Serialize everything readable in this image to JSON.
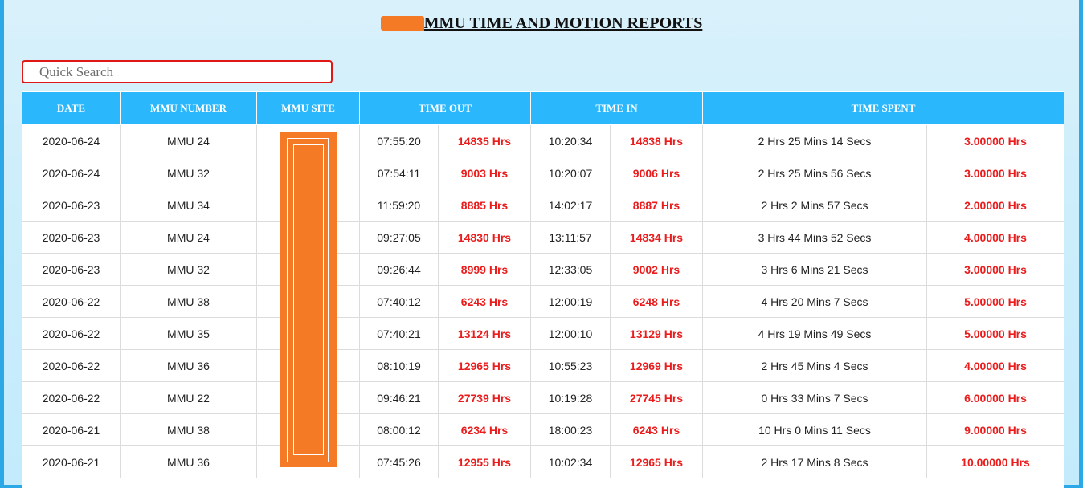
{
  "page": {
    "title": "MMU TIME AND MOTION REPORTS"
  },
  "search": {
    "placeholder": "Quick Search"
  },
  "table": {
    "headers": {
      "date": "DATE",
      "mmu_number": "MMU NUMBER",
      "mmu_site": "MMU SITE",
      "time_out": "TIME OUT",
      "time_in": "TIME IN",
      "time_spent": "TIME SPENT"
    },
    "rows": [
      {
        "date": "2020-06-24",
        "mmu": "MMU 24",
        "time_out": "07:55:20",
        "out_hrs": "14835 Hrs",
        "time_in": "10:20:34",
        "in_hrs": "14838 Hrs",
        "spent": "2 Hrs 25 Mins 14 Secs",
        "spent_hrs": "3.00000 Hrs"
      },
      {
        "date": "2020-06-24",
        "mmu": "MMU 32",
        "time_out": "07:54:11",
        "out_hrs": "9003 Hrs",
        "time_in": "10:20:07",
        "in_hrs": "9006 Hrs",
        "spent": "2 Hrs 25 Mins 56 Secs",
        "spent_hrs": "3.00000 Hrs"
      },
      {
        "date": "2020-06-23",
        "mmu": "MMU 34",
        "time_out": "11:59:20",
        "out_hrs": "8885 Hrs",
        "time_in": "14:02:17",
        "in_hrs": "8887 Hrs",
        "spent": "2 Hrs 2 Mins 57 Secs",
        "spent_hrs": "2.00000 Hrs"
      },
      {
        "date": "2020-06-23",
        "mmu": "MMU 24",
        "time_out": "09:27:05",
        "out_hrs": "14830 Hrs",
        "time_in": "13:11:57",
        "in_hrs": "14834 Hrs",
        "spent": "3 Hrs 44 Mins 52 Secs",
        "spent_hrs": "4.00000 Hrs"
      },
      {
        "date": "2020-06-23",
        "mmu": "MMU 32",
        "time_out": "09:26:44",
        "out_hrs": "8999 Hrs",
        "time_in": "12:33:05",
        "in_hrs": "9002 Hrs",
        "spent": "3 Hrs 6 Mins 21 Secs",
        "spent_hrs": "3.00000 Hrs"
      },
      {
        "date": "2020-06-22",
        "mmu": "MMU 38",
        "time_out": "07:40:12",
        "out_hrs": "6243 Hrs",
        "time_in": "12:00:19",
        "in_hrs": "6248 Hrs",
        "spent": "4 Hrs 20 Mins 7 Secs",
        "spent_hrs": "5.00000 Hrs"
      },
      {
        "date": "2020-06-22",
        "mmu": "MMU 35",
        "time_out": "07:40:21",
        "out_hrs": "13124 Hrs",
        "time_in": "12:00:10",
        "in_hrs": "13129 Hrs",
        "spent": "4 Hrs 19 Mins 49 Secs",
        "spent_hrs": "5.00000 Hrs"
      },
      {
        "date": "2020-06-22",
        "mmu": "MMU 36",
        "time_out": "08:10:19",
        "out_hrs": "12965 Hrs",
        "time_in": "10:55:23",
        "in_hrs": "12969 Hrs",
        "spent": "2 Hrs 45 Mins 4 Secs",
        "spent_hrs": "4.00000 Hrs"
      },
      {
        "date": "2020-06-22",
        "mmu": "MMU 22",
        "time_out": "09:46:21",
        "out_hrs": "27739 Hrs",
        "time_in": "10:19:28",
        "in_hrs": "27745 Hrs",
        "spent": "0 Hrs 33 Mins 7 Secs",
        "spent_hrs": "6.00000 Hrs"
      },
      {
        "date": "2020-06-21",
        "mmu": "MMU 38",
        "time_out": "08:00:12",
        "out_hrs": "6234 Hrs",
        "time_in": "18:00:23",
        "in_hrs": "6243 Hrs",
        "spent": "10 Hrs 0 Mins 11 Secs",
        "spent_hrs": "9.00000 Hrs"
      },
      {
        "date": "2020-06-21",
        "mmu": "MMU 36",
        "time_out": "07:45:26",
        "out_hrs": "12955 Hrs",
        "time_in": "10:02:34",
        "in_hrs": "12965 Hrs",
        "spent": "2 Hrs 17 Mins 8 Secs",
        "spent_hrs": "10.00000 Hrs"
      }
    ]
  },
  "colors": {
    "header_bg": "#2bb7fb",
    "highlight_text": "#ea1c1c",
    "search_border": "#e01717",
    "redaction": "#f47a25"
  }
}
